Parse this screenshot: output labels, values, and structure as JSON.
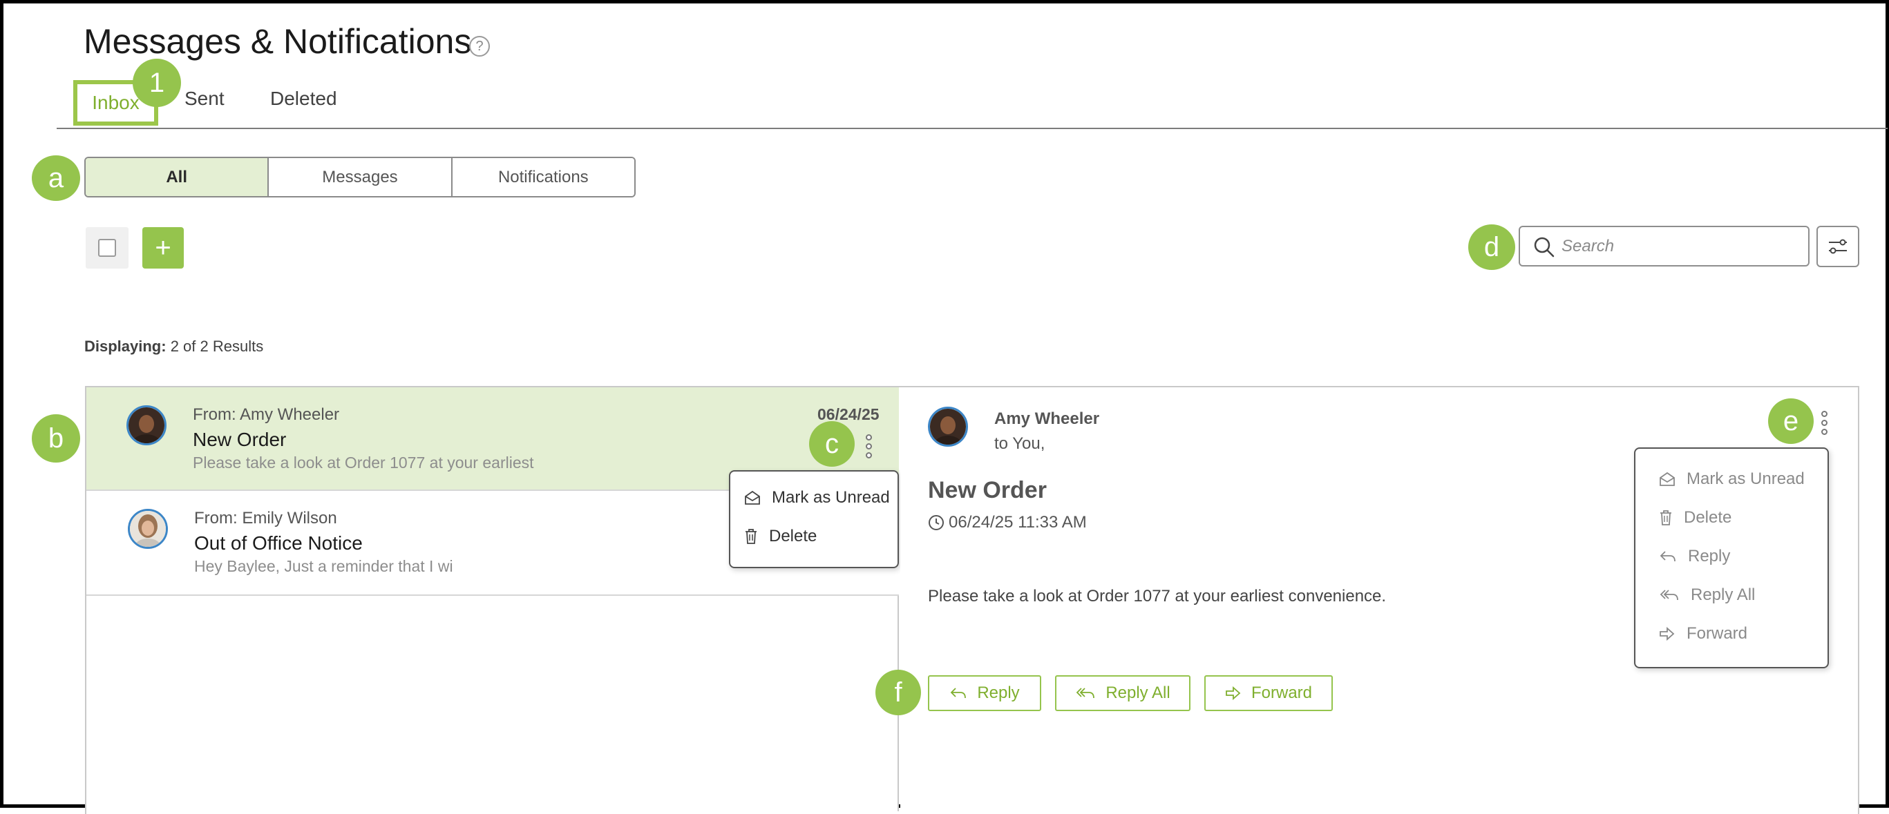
{
  "page": {
    "title": "Messages & Notifications",
    "help_icon": "?"
  },
  "tabs": [
    {
      "label": "Inbox",
      "active": true
    },
    {
      "label": "Sent"
    },
    {
      "label": "Deleted"
    }
  ],
  "badges": {
    "tab": "1",
    "filter": "a",
    "list": "b",
    "row_menu": "c",
    "search": "d",
    "detail_menu": "e",
    "actions": "f"
  },
  "filter_segments": [
    {
      "label": "All",
      "active": true
    },
    {
      "label": "Messages"
    },
    {
      "label": "Notifications"
    }
  ],
  "toolbar": {
    "add_label": "+",
    "search_placeholder": "Search"
  },
  "results": {
    "label": "Displaying:",
    "value": "2 of 2 Results"
  },
  "messages": [
    {
      "from": "From: Amy Wheeler",
      "subject": "New Order",
      "preview": "Please take a look at Order 1077 at your earliest",
      "date": "06/24/25",
      "selected": true
    },
    {
      "from": "From: Emily Wilson",
      "subject": "Out of Office Notice",
      "preview": "Hey Baylee,    Just a reminder that I wi",
      "date": ""
    }
  ],
  "row_menu": [
    {
      "label": "Mark as Unread",
      "icon": "envelope-open-icon"
    },
    {
      "label": "Delete",
      "icon": "trash-icon"
    }
  ],
  "detail": {
    "sender": "Amy Wheeler",
    "recipient": "to You,",
    "subject": "New Order",
    "datetime": "06/24/25 11:33 AM",
    "body": "Please take a look at Order 1077 at your earliest convenience."
  },
  "detail_menu": [
    {
      "label": "Mark as Unread",
      "icon": "envelope-open-icon"
    },
    {
      "label": "Delete",
      "icon": "trash-icon"
    },
    {
      "label": "Reply",
      "icon": "reply-icon"
    },
    {
      "label": "Reply All",
      "icon": "reply-all-icon"
    },
    {
      "label": "Forward",
      "icon": "forward-icon"
    }
  ],
  "actions": [
    {
      "label": "Reply",
      "icon": "reply-icon"
    },
    {
      "label": "Reply All",
      "icon": "reply-all-icon"
    },
    {
      "label": "Forward",
      "icon": "forward-icon"
    }
  ],
  "colors": {
    "accent": "#95c44d",
    "accent_text": "#7faf2e",
    "selected_row": "#e4efd3",
    "avatar_ring": "#3c86c7"
  }
}
